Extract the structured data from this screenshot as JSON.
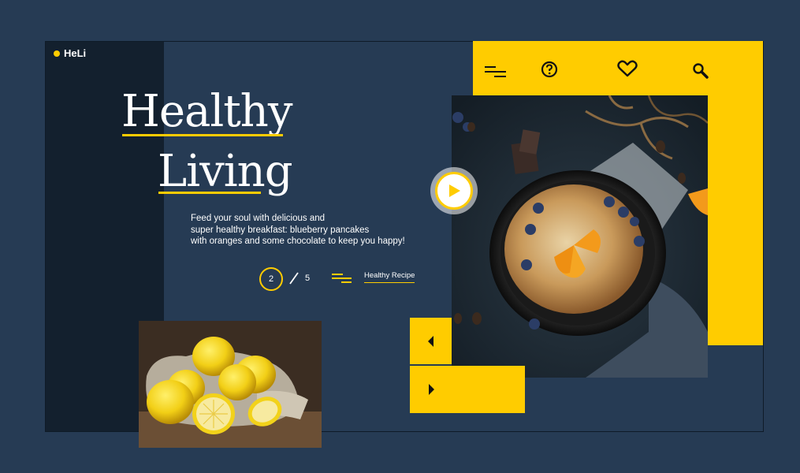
{
  "brand": {
    "name": "HeLi",
    "accent": "#ffcc00"
  },
  "hero": {
    "title_line1": "Healthy",
    "title_line2": "Living",
    "description": [
      "Feed your soul with delicious and",
      "super healthy breakfast: blueberry pancakes",
      "with oranges and some chocolate to keep you happy!"
    ]
  },
  "pager": {
    "current": "2",
    "separator": "/",
    "total": "5"
  },
  "recipe": {
    "link_label": "Healthy Recipe",
    "icon": "lines-icon"
  },
  "nav": {
    "icons": [
      "menu-icon",
      "help-icon",
      "heart-icon",
      "search-icon"
    ]
  },
  "media": {
    "main_photo": "pancake-skillet-photo",
    "secondary_photo": "lemons-in-sack-photo",
    "play_icon": "play-icon"
  },
  "controls": {
    "prev_icon": "chevron-left-icon",
    "next_icon": "chevron-right-icon"
  },
  "colors": {
    "background": "#263b54",
    "sidebar": "#13202e",
    "accent": "#ffcc00"
  }
}
